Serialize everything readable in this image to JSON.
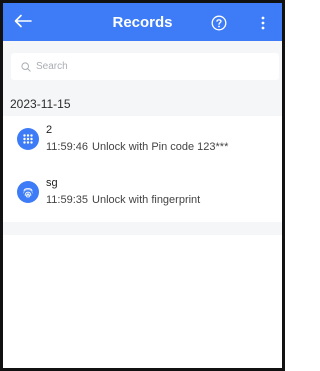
{
  "header": {
    "title": "Records",
    "back_icon": "arrow-left-icon",
    "help_icon": "question-circle-icon",
    "more_icon": "more-vertical-icon"
  },
  "search": {
    "placeholder": "Search",
    "icon": "search-icon"
  },
  "date_group": "2023-11-15",
  "records": [
    {
      "name": "2",
      "time": "11:59:46",
      "description": "Unlock with Pin code 123***",
      "icon": "keypad-icon"
    },
    {
      "name": "sg",
      "time": "11:59:35",
      "description": "Unlock with fingerprint",
      "icon": "fingerprint-icon"
    }
  ],
  "colors": {
    "accent": "#3d7cf6",
    "background": "#f5f6f8"
  }
}
